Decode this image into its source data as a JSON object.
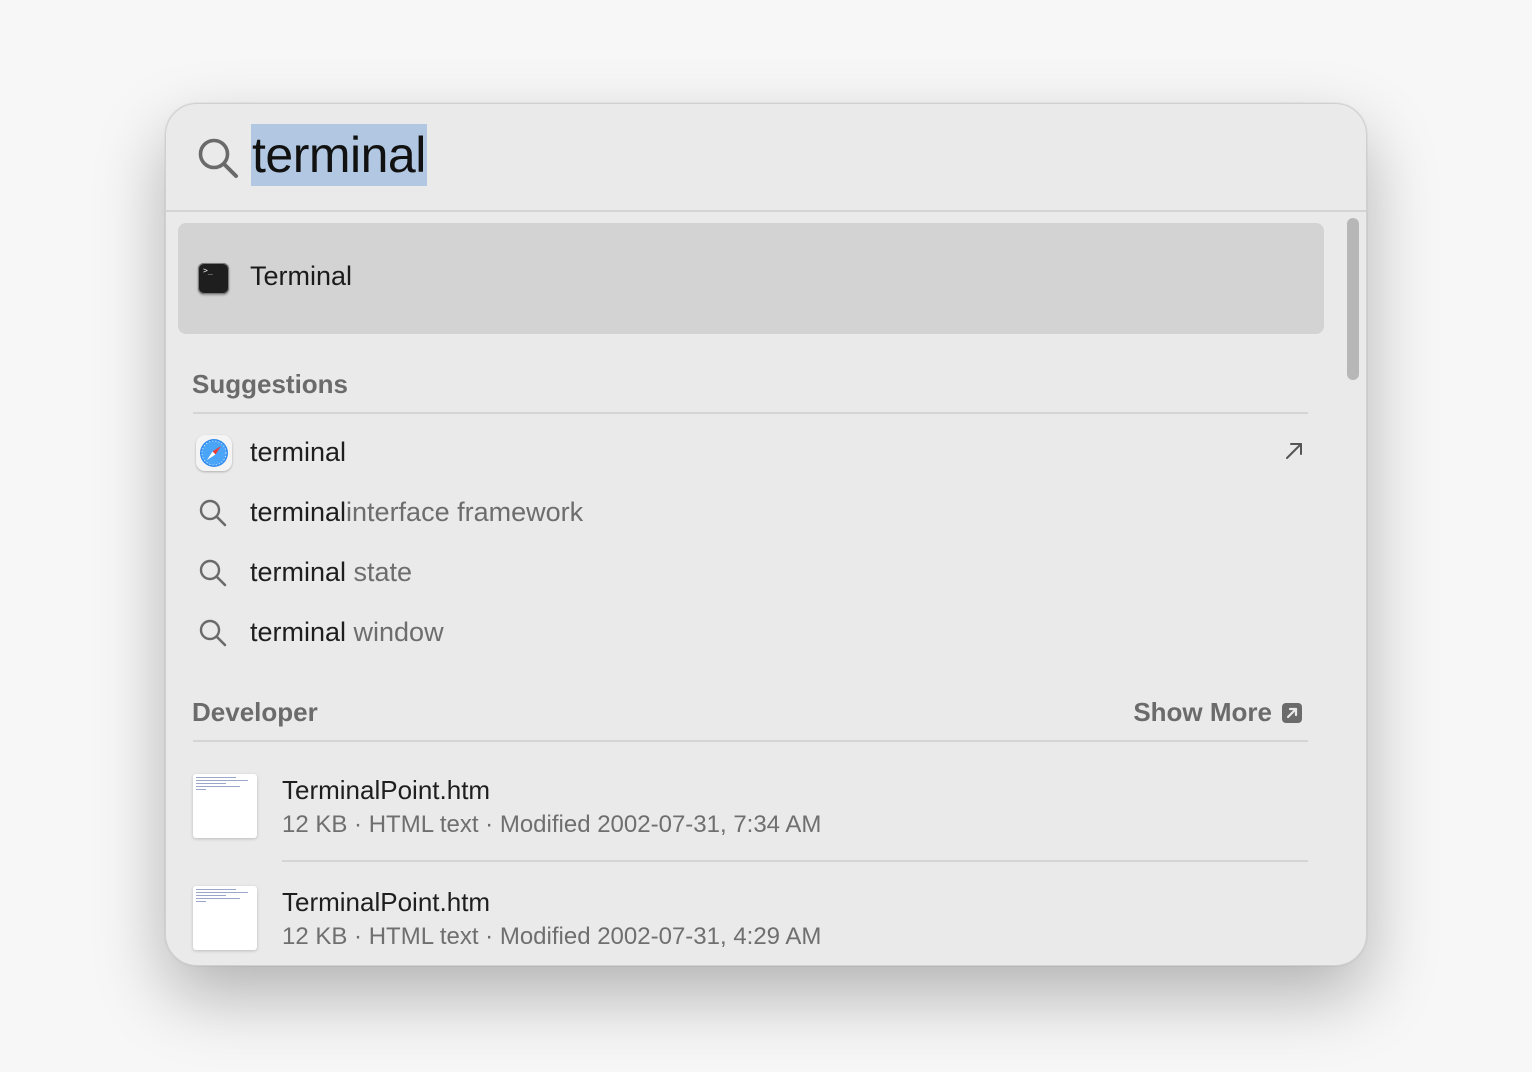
{
  "search": {
    "query": "terminal"
  },
  "top_hit": {
    "label": "Terminal",
    "icon": "terminal-app-icon",
    "icon_glyph": ">_"
  },
  "suggestions": {
    "header": "Suggestions",
    "items": [
      {
        "icon": "safari-icon",
        "prefix": "terminal",
        "suffix": "",
        "action_icon": "open-arrow-icon"
      },
      {
        "icon": "search-icon",
        "prefix": "terminal",
        "suffix": "interface framework"
      },
      {
        "icon": "search-icon",
        "prefix": "terminal",
        "suffix": " state"
      },
      {
        "icon": "search-icon",
        "prefix": "terminal",
        "suffix": " window"
      }
    ]
  },
  "developer": {
    "header": "Developer",
    "show_more": "Show More",
    "files": [
      {
        "name": "TerminalPoint.htm",
        "meta": "12 KB · HTML text · Modified 2002-07-31, 7:34 AM"
      },
      {
        "name": "TerminalPoint.htm",
        "meta": "12 KB · HTML text · Modified 2002-07-31, 4:29 AM"
      }
    ]
  },
  "colors": {
    "selection_highlight": "#b2c8e2",
    "panel_background": "#eaeaea",
    "top_hit_background": "#d3d3d3",
    "secondary_text": "#6b6b6b"
  }
}
